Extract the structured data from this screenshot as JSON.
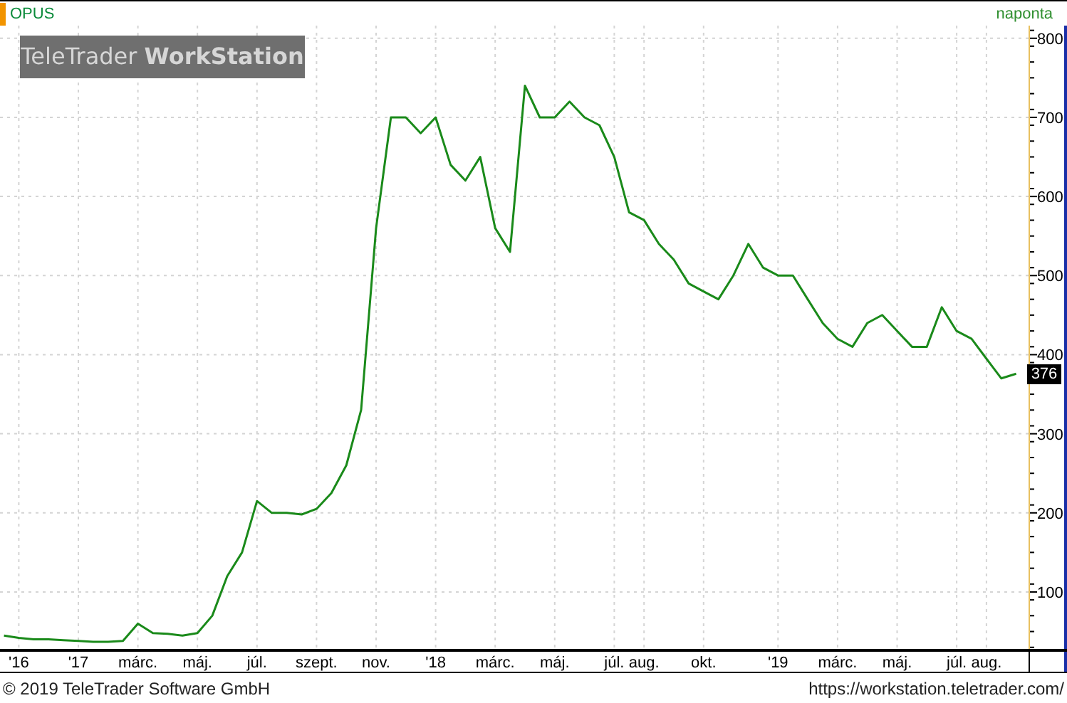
{
  "header": {
    "symbol": "OPUS",
    "interval": "naponta"
  },
  "logo": "TeleTrader **WorkStation**",
  "last_price": "376",
  "chart_data": {
    "type": "line",
    "grid": true,
    "ylim": [
      28,
      816
    ],
    "yticks": [
      100,
      200,
      300,
      400,
      500,
      600,
      700,
      800
    ],
    "categories": [
      null,
      "'16",
      null,
      null,
      null,
      "'17",
      null,
      null,
      null,
      "márc.",
      null,
      null,
      null,
      "máj.",
      null,
      null,
      null,
      "júl.",
      null,
      null,
      null,
      "szept.",
      null,
      null,
      null,
      "nov.",
      null,
      null,
      null,
      "'18",
      null,
      null,
      null,
      "márc.",
      null,
      null,
      null,
      "máj.",
      null,
      null,
      null,
      "júl.",
      null,
      "aug.",
      null,
      null,
      null,
      "okt.",
      null,
      null,
      null,
      null,
      "'19",
      null,
      null,
      null,
      "márc.",
      null,
      null,
      null,
      "máj.",
      null,
      null,
      null,
      "júl.",
      null,
      "aug.",
      null,
      null
    ],
    "series": [
      {
        "color": "#1a8a1a",
        "values": [
          45,
          42,
          40,
          40,
          39,
          38,
          37,
          37,
          38,
          60,
          48,
          47,
          45,
          48,
          70,
          120,
          150,
          215,
          200,
          200,
          198,
          205,
          225,
          260,
          330,
          560,
          700,
          700,
          680,
          700,
          640,
          620,
          650,
          560,
          530,
          740,
          700,
          700,
          720,
          700,
          690,
          650,
          580,
          570,
          540,
          520,
          490,
          480,
          470,
          500,
          540,
          510,
          500,
          500,
          470,
          440,
          420,
          410,
          440,
          450,
          430,
          410,
          410,
          460,
          430,
          420,
          395,
          370,
          376
        ]
      }
    ]
  },
  "footer": {
    "copyright": "© 2019 TeleTrader Software GmbH",
    "url": "https://workstation.teletrader.com/"
  }
}
